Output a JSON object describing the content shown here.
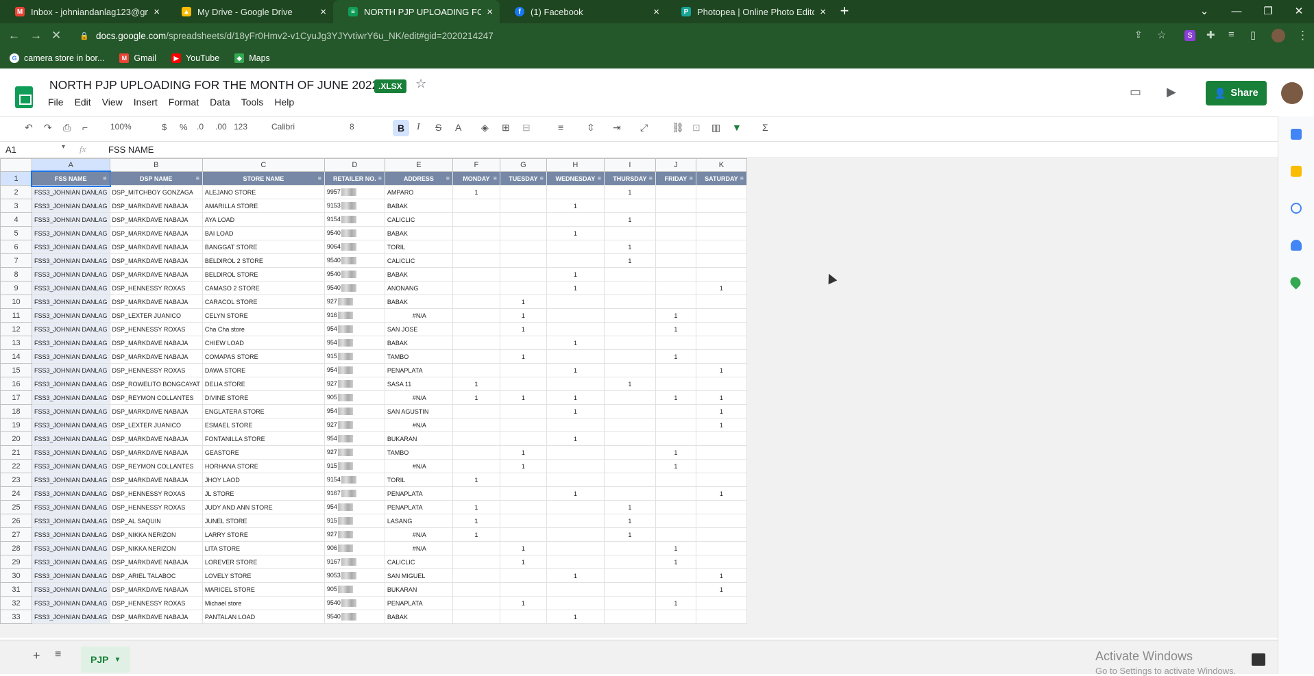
{
  "browser": {
    "tabs": [
      {
        "title": "Inbox - johniandanlag123@gmail",
        "icon": "gmail-icon",
        "active": false
      },
      {
        "title": "My Drive - Google Drive",
        "icon": "drive-icon",
        "active": false
      },
      {
        "title": "NORTH PJP UPLOADING FOR THE",
        "icon": "sheets-icon",
        "active": true
      },
      {
        "title": "(1) Facebook",
        "icon": "facebook-icon",
        "active": false
      },
      {
        "title": "Photopea | Online Photo Editor",
        "icon": "photopea-icon",
        "active": false
      }
    ],
    "url_host": "docs.google.com",
    "url_path": "/spreadsheets/d/18yFr0Hmv2-v1CyuJg3YJYvtiwrY6u_NK/edit#gid=2020214247",
    "bookmarks": [
      {
        "label": "camera store in bor...",
        "icon": "google-icon"
      },
      {
        "label": "Gmail",
        "icon": "gmail-icon"
      },
      {
        "label": "YouTube",
        "icon": "youtube-icon"
      },
      {
        "label": "Maps",
        "icon": "maps-icon"
      }
    ]
  },
  "doc": {
    "title": "NORTH PJP UPLOADING FOR THE MONTH OF JUNE 2022",
    "badge": ".XLSX",
    "menus": [
      "File",
      "Edit",
      "View",
      "Insert",
      "Format",
      "Data",
      "Tools",
      "Help"
    ],
    "share_label": "Share"
  },
  "toolbar": {
    "zoom": "100%",
    "currency": "$",
    "percent": "%",
    "dec_less": ".0",
    "dec_more": ".00",
    "format": "123",
    "font": "Calibri",
    "font_size": "8"
  },
  "formula": {
    "cell_ref": "A1",
    "fx": "fx",
    "content": "FSS NAME"
  },
  "sheet": {
    "columns": [
      "A",
      "B",
      "C",
      "D",
      "E",
      "F",
      "G",
      "H",
      "I",
      "J",
      "K"
    ],
    "headers": [
      "FSS NAME",
      "DSP NAME",
      "STORE NAME",
      "RETAILER NO.",
      "ADDRESS",
      "MONDAY",
      "TUESDAY",
      "WEDNESDAY",
      "THURSDAY",
      "FRIDAY",
      "SATURDAY"
    ],
    "rows": [
      [
        "FSS3_JOHNIAN DANLAG",
        "DSP_MITCHBOY GONZAGA",
        "ALEJANO STORE",
        "9957",
        "AMPARO",
        "1",
        "",
        "",
        "1",
        "",
        ""
      ],
      [
        "FSS3_JOHNIAN DANLAG",
        "DSP_MARKDAVE NABAJA",
        "AMARILLA STORE",
        "9153",
        "BABAK",
        "",
        "",
        "1",
        "",
        "",
        ""
      ],
      [
        "FSS3_JOHNIAN DANLAG",
        "DSP_MARKDAVE NABAJA",
        "AYA LOAD",
        "9154",
        "CALICLIC",
        "",
        "",
        "",
        "1",
        "",
        ""
      ],
      [
        "FSS3_JOHNIAN DANLAG",
        "DSP_MARKDAVE NABAJA",
        "BAI LOAD",
        "9540",
        "BABAK",
        "",
        "",
        "1",
        "",
        "",
        ""
      ],
      [
        "FSS3_JOHNIAN DANLAG",
        "DSP_MARKDAVE NABAJA",
        "BANGGAT STORE",
        "9064",
        "TORIL",
        "",
        "",
        "",
        "1",
        "",
        ""
      ],
      [
        "FSS3_JOHNIAN DANLAG",
        "DSP_MARKDAVE NABAJA",
        "BELDIROL 2 STORE",
        "9540",
        "CALICLIC",
        "",
        "",
        "",
        "1",
        "",
        ""
      ],
      [
        "FSS3_JOHNIAN DANLAG",
        "DSP_MARKDAVE NABAJA",
        "BELDIROL STORE",
        "9540",
        "BABAK",
        "",
        "",
        "1",
        "",
        "",
        ""
      ],
      [
        "FSS3_JOHNIAN DANLAG",
        "DSP_HENNESSY ROXAS",
        "CAMASO 2 STORE",
        "9540",
        "ANONANG",
        "",
        "",
        "1",
        "",
        "",
        "1"
      ],
      [
        "FSS3_JOHNIAN DANLAG",
        "DSP_MARKDAVE NABAJA",
        "CARACOL STORE",
        "927",
        "BABAK",
        "",
        "1",
        "",
        "",
        "",
        ""
      ],
      [
        "FSS3_JOHNIAN DANLAG",
        "DSP_LEXTER JUANICO",
        "CELYN STORE",
        "916",
        "#N/A",
        "",
        "1",
        "",
        "",
        "1",
        ""
      ],
      [
        "FSS3_JOHNIAN DANLAG",
        "DSP_HENNESSY ROXAS",
        "Cha Cha store",
        "954",
        "SAN JOSE",
        "",
        "1",
        "",
        "",
        "1",
        ""
      ],
      [
        "FSS3_JOHNIAN DANLAG",
        "DSP_MARKDAVE NABAJA",
        "CHIEW LOAD",
        "954",
        "BABAK",
        "",
        "",
        "1",
        "",
        "",
        ""
      ],
      [
        "FSS3_JOHNIAN DANLAG",
        "DSP_MARKDAVE NABAJA",
        "COMAPAS STORE",
        "915",
        "TAMBO",
        "",
        "1",
        "",
        "",
        "1",
        ""
      ],
      [
        "FSS3_JOHNIAN DANLAG",
        "DSP_HENNESSY ROXAS",
        "DAWA STORE",
        "954",
        "PENAPLATA",
        "",
        "",
        "1",
        "",
        "",
        "1"
      ],
      [
        "FSS3_JOHNIAN DANLAG",
        "DSP_ROWELITO BONGCAYAT",
        "DELIA STORE",
        "927",
        "SASA 11",
        "1",
        "",
        "",
        "1",
        "",
        ""
      ],
      [
        "FSS3_JOHNIAN DANLAG",
        "DSP_REYMON COLLANTES",
        "DIVINE STORE",
        "905",
        "#N/A",
        "1",
        "1",
        "1",
        "",
        "1",
        "1"
      ],
      [
        "FSS3_JOHNIAN DANLAG",
        "DSP_MARKDAVE NABAJA",
        "ENGLATERA STORE",
        "954",
        "SAN AGUSTIN",
        "",
        "",
        "1",
        "",
        "",
        "1"
      ],
      [
        "FSS3_JOHNIAN DANLAG",
        "DSP_LEXTER JUANICO",
        "ESMAEL STORE",
        "927",
        "#N/A",
        "",
        "",
        "",
        "",
        "",
        "1"
      ],
      [
        "FSS3_JOHNIAN DANLAG",
        "DSP_MARKDAVE NABAJA",
        "FONTANILLA STORE",
        "954",
        "BUKARAN",
        "",
        "",
        "1",
        "",
        "",
        ""
      ],
      [
        "FSS3_JOHNIAN DANLAG",
        "DSP_MARKDAVE NABAJA",
        "GEASTORE",
        "927",
        "TAMBO",
        "",
        "1",
        "",
        "",
        "1",
        ""
      ],
      [
        "FSS3_JOHNIAN DANLAG",
        "DSP_REYMON COLLANTES",
        "HORHANA STORE",
        "915",
        "#N/A",
        "",
        "1",
        "",
        "",
        "1",
        ""
      ],
      [
        "FSS3_JOHNIAN DANLAG",
        "DSP_MARKDAVE NABAJA",
        "JHOY LAOD",
        "9154",
        "TORIL",
        "1",
        "",
        "",
        "",
        "",
        ""
      ],
      [
        "FSS3_JOHNIAN DANLAG",
        "DSP_HENNESSY ROXAS",
        "JL STORE",
        "9167",
        "PENAPLATA",
        "",
        "",
        "1",
        "",
        "",
        "1"
      ],
      [
        "FSS3_JOHNIAN DANLAG",
        "DSP_HENNESSY ROXAS",
        "JUDY AND ANN STORE",
        "954",
        "PENAPLATA",
        "1",
        "",
        "",
        "1",
        "",
        ""
      ],
      [
        "FSS3_JOHNIAN DANLAG",
        "DSP_AL SAQUIN",
        "JUNEL STORE",
        "915",
        "LASANG",
        "1",
        "",
        "",
        "1",
        "",
        ""
      ],
      [
        "FSS3_JOHNIAN DANLAG",
        "DSP_NIKKA NERIZON",
        "LARRY STORE",
        "927",
        "#N/A",
        "1",
        "",
        "",
        "1",
        "",
        ""
      ],
      [
        "FSS3_JOHNIAN DANLAG",
        "DSP_NIKKA NERIZON",
        "LITA STORE",
        "906",
        "#N/A",
        "",
        "1",
        "",
        "",
        "1",
        ""
      ],
      [
        "FSS3_JOHNIAN DANLAG",
        "DSP_MARKDAVE NABAJA",
        "LOREVER STORE",
        "9167",
        "CALICLIC",
        "",
        "1",
        "",
        "",
        "1",
        ""
      ],
      [
        "FSS3_JOHNIAN DANLAG",
        "DSP_ARIEL TALABOC",
        "LOVELY STORE",
        "9053",
        "SAN MIGUEL",
        "",
        "",
        "1",
        "",
        "",
        "1"
      ],
      [
        "FSS3_JOHNIAN DANLAG",
        "DSP_MARKDAVE NABAJA",
        "MARICEL STORE",
        "905",
        "BUKARAN",
        "",
        "",
        "",
        "",
        "",
        "1"
      ],
      [
        "FSS3_JOHNIAN DANLAG",
        "DSP_HENNESSY ROXAS",
        "Michael store",
        "9540",
        "PENAPLATA",
        "",
        "1",
        "",
        "",
        "1",
        ""
      ],
      [
        "FSS3_JOHNIAN DANLAG",
        "DSP_MARKDAVE NABAJA",
        "PANTALAN LOAD",
        "9540",
        "BABAK",
        "",
        "",
        "1",
        "",
        "",
        ""
      ]
    ],
    "tab_name": "PJP",
    "watermark": "Activate Windows",
    "watermark_sub": "Go to Settings to activate Windows."
  }
}
